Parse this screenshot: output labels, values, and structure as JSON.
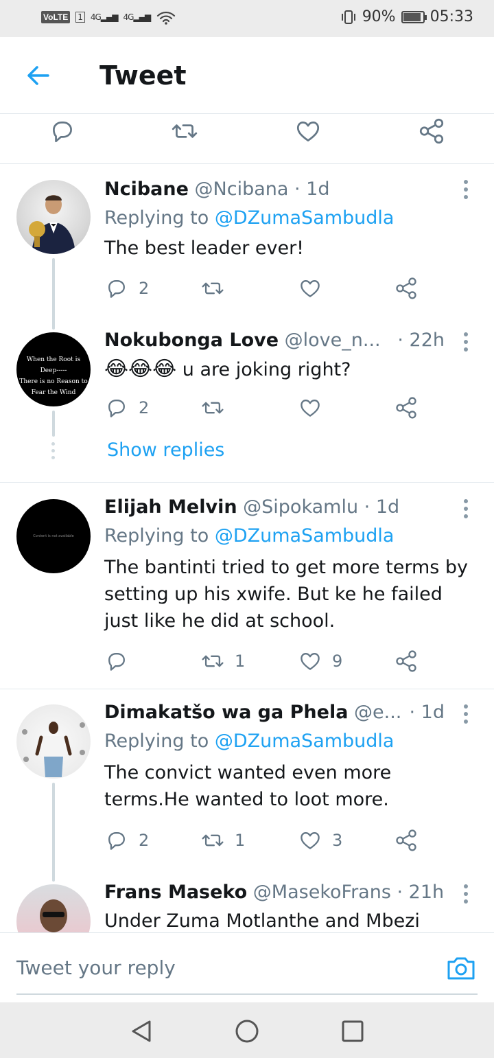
{
  "status_bar": {
    "volte": "VoLTE",
    "sim": "1",
    "net1": "4G",
    "net2": "4G",
    "battery": "90%",
    "battery_level": 0.9,
    "time": "05:33"
  },
  "header": {
    "title": "Tweet",
    "back_icon": "arrow-left-icon"
  },
  "colors": {
    "accent": "#1da1f2",
    "muted": "#657786",
    "text": "#14171a",
    "divider": "#e1e8ed"
  },
  "tweets": [
    {
      "name": "Ncibane",
      "handle": "@Ncibana",
      "time": "· 1d",
      "replying_prefix": "Replying to",
      "replying_to": "@DZumaSambudla",
      "text": "The best leader ever!",
      "replies": "2",
      "retweets": "",
      "likes": ""
    },
    {
      "name": "Nokubonga Love",
      "handle": "@love_n...",
      "time": "· 22h",
      "emoji": "😂😂😂",
      "text": "u are joking right?",
      "replies": "2",
      "retweets": "",
      "likes": "",
      "show_replies": "Show replies",
      "avatar_text": [
        "When the Root is",
        "Deep-----",
        "There is no Reason to",
        "Fear the Wind"
      ]
    },
    {
      "name": "Elijah Melvin",
      "handle": "@Sipokamlu",
      "time": "· 1d",
      "replying_prefix": "Replying to",
      "replying_to": "@DZumaSambudla",
      "text_lines": [
        "The bantinti tried to get more terms by",
        "setting up his xwife. But ke he failed",
        "just like he did at school."
      ],
      "replies": "",
      "retweets": "1",
      "likes": "9",
      "avatar_text": "Content is not available"
    },
    {
      "name": "Dimakatšo wa ga Phela",
      "handle": "@e...",
      "time": "· 1d",
      "replying_prefix": "Replying to",
      "replying_to": "@DZumaSambudla",
      "text_lines": [
        "The convict wanted even more",
        "terms.He wanted to loot more."
      ],
      "replies": "2",
      "retweets": "1",
      "likes": "3"
    },
    {
      "name": "Frans Maseko",
      "handle": "@MasekoFrans",
      "time": "· 21h",
      "text": "Under Zuma Motlanthe and Mbezi"
    }
  ],
  "reply_bar": {
    "placeholder": "Tweet your reply",
    "camera_icon": "camera-icon"
  },
  "nav": {
    "back": "nav-back-icon",
    "home": "nav-home-icon",
    "recents": "nav-recents-icon"
  }
}
